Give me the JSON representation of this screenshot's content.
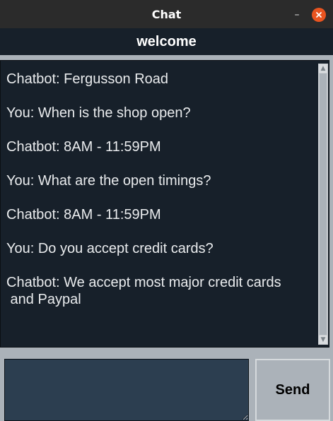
{
  "window": {
    "title": "Chat",
    "minimize_glyph": "–",
    "close_icon": "close-icon"
  },
  "header": {
    "label": "welcome"
  },
  "chat": {
    "messages": [
      "Chatbot: Fergusson Road",
      "You: When is the shop open?",
      "Chatbot: 8AM - 11:59PM",
      "You: What are the open timings?",
      "Chatbot: 8AM - 11:59PM",
      "You: Do you accept credit cards?",
      "Chatbot: We accept most major credit cards\n and Paypal"
    ]
  },
  "input": {
    "value": ""
  },
  "send": {
    "label": "Send"
  },
  "colors": {
    "title_bar": "#2b2b2b",
    "header_bg": "#17202a",
    "chat_bg": "#17202a",
    "input_bg": "#2c3e50",
    "button_bg": "#abb2b9",
    "close_button": "#e95420"
  }
}
